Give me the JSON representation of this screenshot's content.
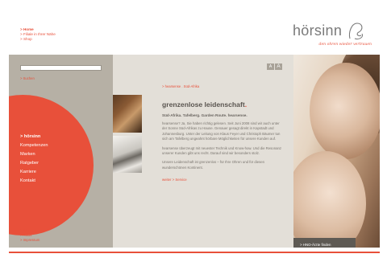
{
  "top_nav": {
    "items": [
      {
        "label": "> Home"
      },
      {
        "label": "> Filiale in Ihrer Nähe"
      },
      {
        "label": "> Shop"
      }
    ]
  },
  "logo": {
    "wordmark": "hörsinn",
    "tagline": "den ohren wieder vertrauen"
  },
  "sidebar": {
    "search_label": "> Suchen",
    "main_nav": [
      {
        "label": "> hörsinn"
      },
      {
        "label": "Kompetenzen"
      },
      {
        "label": "Marken"
      },
      {
        "label": "Ratgeber"
      },
      {
        "label": "Karriere"
      },
      {
        "label": "Kontakt"
      }
    ],
    "sub_nav": [
      {
        "label": "> Sitemap"
      },
      {
        "label": "> AGBs"
      },
      {
        "label": "> Impressum"
      }
    ]
  },
  "content": {
    "font_small": "A",
    "font_large": "A",
    "breadcrumb": "> hearsense . Süd-Afrika",
    "headline": "grenzenlose leidenschaft",
    "headline_dot": ".",
    "lead": "Süd-Afrika. Tafelberg. Garden Route. hearsense.",
    "paragraphs": [
      "hearsense? Ja, Sie haben richtig gelesen. Seit Juni 2008 sind wir auch unter der Sonne Süd-Afrikas zu Hause. Genauer gesagt direkt in Kapstadt und Johannesburg. Unter der Leitung von Klaus Feyer und Christoph Bäumer tun sich am Tafelberg ungeahnt hörbare Möglichkeiten für unsere Kunden auf.",
      "hearsense überzeugt mit neuester Technik und Know-how. Und die Resonanz unserer Kunden gibt uns recht. Darauf sind wir besonders stolz.",
      "Unsere Leidenschaft ist grenzenlos – für Ihre Ohren und für diesen wunderschönen Kontinent."
    ],
    "more_link": "weiter > Service"
  },
  "hero": {
    "button_label": "> HNO-Ärzte finden"
  },
  "colors": {
    "accent": "#e8503a",
    "sidebar_bg": "#b6b0a5",
    "content_bg": "#e3dfd8",
    "button_bg": "#5e5a54"
  }
}
